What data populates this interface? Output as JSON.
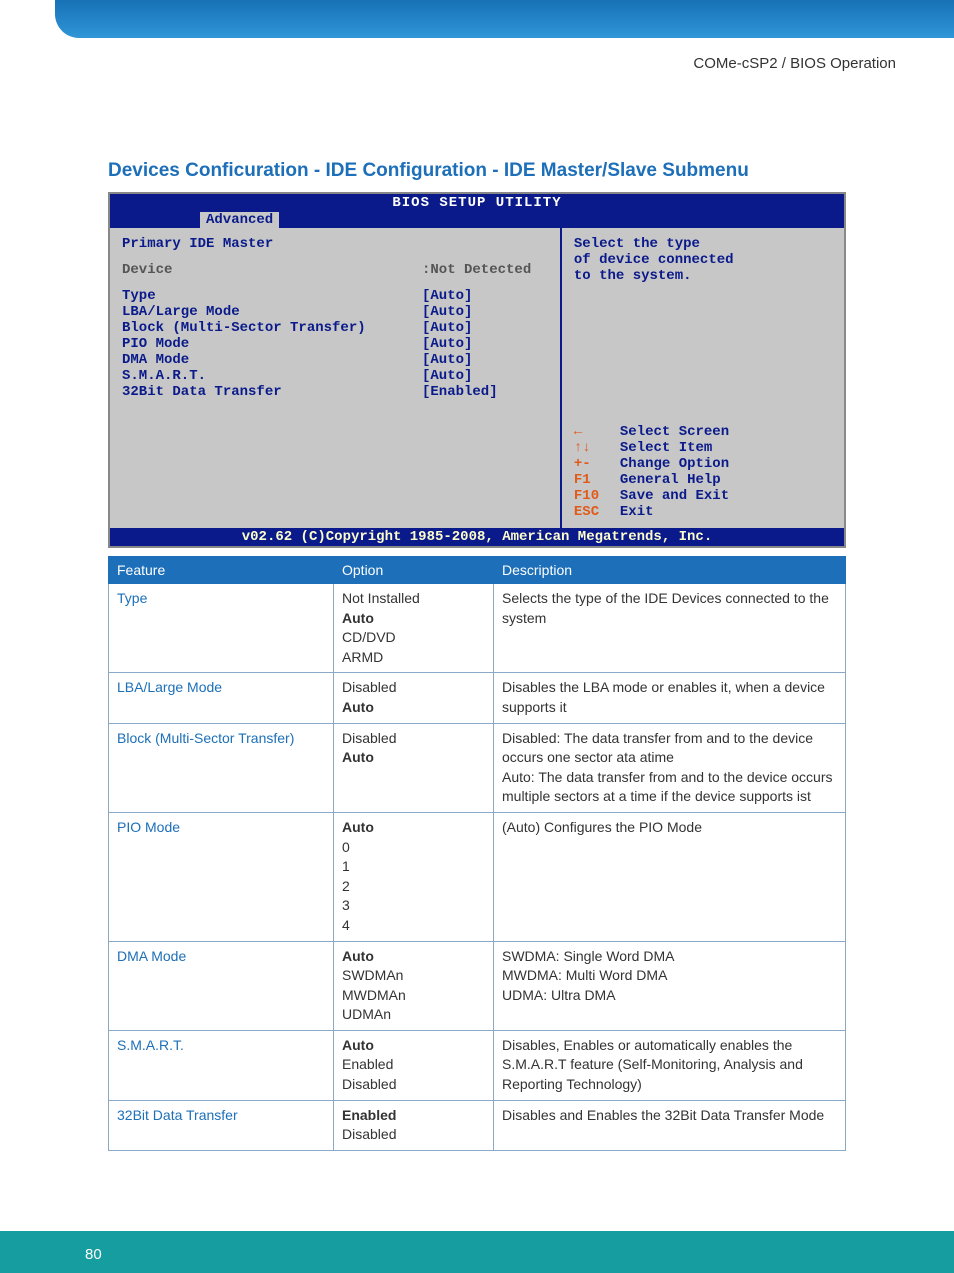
{
  "header": {
    "breadcrumb": "COMe-cSP2 / BIOS Operation"
  },
  "section": {
    "title": "Devices Conficuration - IDE Configuration - IDE Master/Slave Submenu"
  },
  "bios": {
    "title": "BIOS SETUP UTILITY",
    "tab": "Advanced",
    "heading": "Primary IDE Master",
    "device_label": "Device",
    "device_value": ":Not Detected",
    "rows": [
      {
        "label": "Type",
        "value": "[Auto]"
      },
      {
        "label": "LBA/Large Mode",
        "value": "[Auto]"
      },
      {
        "label": "Block (Multi-Sector Transfer)",
        "value": "[Auto]"
      },
      {
        "label": "PIO Mode",
        "value": "[Auto]"
      },
      {
        "label": "DMA Mode",
        "value": "[Auto]"
      },
      {
        "label": "S.M.A.R.T.",
        "value": "[Auto]"
      },
      {
        "label": "32Bit Data Transfer",
        "value": "[Enabled]"
      }
    ],
    "help_text": "Select the type\nof device connected\nto the system.",
    "help_keys": [
      {
        "key": "←",
        "desc": "Select Screen"
      },
      {
        "key": "↑↓",
        "desc": "Select Item"
      },
      {
        "key": "+-",
        "desc": "Change Option"
      },
      {
        "key": "F1",
        "desc": "General Help"
      },
      {
        "key": "F10",
        "desc": "Save and Exit"
      },
      {
        "key": "ESC",
        "desc": "Exit"
      }
    ],
    "footer": "v02.62 (C)Copyright 1985-2008, American Megatrends, Inc."
  },
  "table": {
    "headers": {
      "c1": "Feature",
      "c2": "Option",
      "c3": "Description"
    },
    "rows": [
      {
        "feature": "Type",
        "options": [
          {
            "text": "Not Installed",
            "bold": false
          },
          {
            "text": "Auto",
            "bold": true
          },
          {
            "text": "CD/DVD",
            "bold": false
          },
          {
            "text": "ARMD",
            "bold": false
          }
        ],
        "desc": "Selects the type of the IDE Devices connected to the system"
      },
      {
        "feature": "LBA/Large Mode",
        "options": [
          {
            "text": "Disabled",
            "bold": false
          },
          {
            "text": "Auto",
            "bold": true
          }
        ],
        "desc": "Disables the LBA mode or enables it, when a device supports it"
      },
      {
        "feature": "Block (Multi-Sector Transfer)",
        "options": [
          {
            "text": "Disabled",
            "bold": false
          },
          {
            "text": "Auto",
            "bold": true
          }
        ],
        "desc": "Disabled: The data transfer from and to the device occurs one sector ata atime\nAuto: The data transfer from and to the device occurs multiple sectors at a time if the device supports ist"
      },
      {
        "feature": "PIO Mode",
        "options": [
          {
            "text": "Auto",
            "bold": true
          },
          {
            "text": "0",
            "bold": false
          },
          {
            "text": "1",
            "bold": false
          },
          {
            "text": "2",
            "bold": false
          },
          {
            "text": "3",
            "bold": false
          },
          {
            "text": "4",
            "bold": false
          }
        ],
        "desc": "(Auto) Configures the PIO Mode"
      },
      {
        "feature": "DMA Mode",
        "options": [
          {
            "text": "Auto",
            "bold": true
          },
          {
            "text": "SWDMAn",
            "bold": false
          },
          {
            "text": "MWDMAn",
            "bold": false
          },
          {
            "text": "UDMAn",
            "bold": false
          }
        ],
        "desc": "SWDMA: Single Word DMA\nMWDMA: Multi Word DMA\nUDMA: Ultra DMA"
      },
      {
        "feature": "S.M.A.R.T.",
        "options": [
          {
            "text": "Auto",
            "bold": true
          },
          {
            "text": "Enabled",
            "bold": false
          },
          {
            "text": "Disabled",
            "bold": false
          }
        ],
        "desc": "Disables, Enables or automatically enables the S.M.A.R.T feature (Self-Monitoring, Analysis and Reporting Technology)"
      },
      {
        "feature": "32Bit Data Transfer",
        "options": [
          {
            "text": "Enabled",
            "bold": true
          },
          {
            "text": "Disabled",
            "bold": false
          }
        ],
        "desc": "Disables and Enables the 32Bit Data Transfer Mode"
      }
    ]
  },
  "footer": {
    "page_number": "80"
  }
}
